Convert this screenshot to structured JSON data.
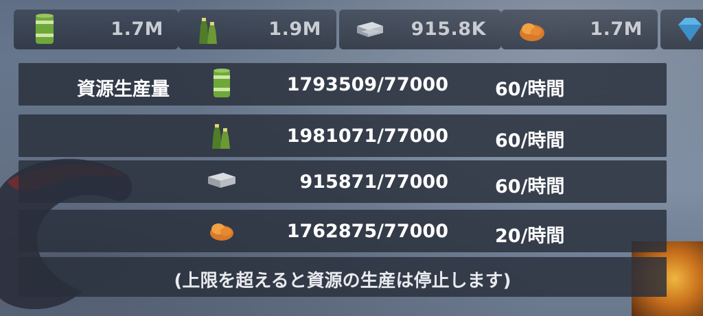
{
  "topbar": {
    "resources": [
      {
        "icon": "oil-barrel-icon",
        "value": "1.7M"
      },
      {
        "icon": "bottles-icon",
        "value": "1.9M"
      },
      {
        "icon": "steel-ingot-icon",
        "value": "915.8K"
      },
      {
        "icon": "ore-icon",
        "value": "1.7M"
      },
      {
        "icon": "diamond-icon",
        "value": ""
      }
    ]
  },
  "production": {
    "title": "資源生産量",
    "rows": [
      {
        "icon": "oil-barrel-icon",
        "amount": "1793509/77000",
        "rate": "60/時間"
      },
      {
        "icon": "bottles-icon",
        "amount": "1981071/77000",
        "rate": "60/時間"
      },
      {
        "icon": "steel-ingot-icon",
        "amount": "915871/77000",
        "rate": "60/時間"
      },
      {
        "icon": "ore-icon",
        "amount": "1762875/77000",
        "rate": "20/時間"
      }
    ],
    "note": "(上限を超えると資源の生産は停止します)"
  }
}
